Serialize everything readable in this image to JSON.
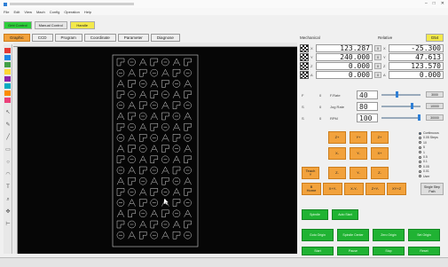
{
  "window": {
    "title": "",
    "controls": [
      "–",
      "□",
      "✕"
    ]
  },
  "menu": {
    "items": [
      "File",
      "Edit",
      "View",
      "Mach",
      "Config",
      "Operation",
      "Help"
    ]
  },
  "modes": [
    {
      "label": "Grbl Control",
      "color": "#2ccf3a"
    },
    {
      "label": "Manual Control",
      "color": "#e6e6e6"
    },
    {
      "label": "Handle",
      "color": "#f3e94a"
    }
  ],
  "tabs": [
    {
      "label": "Graphic",
      "active": true
    },
    {
      "label": "CCD",
      "active": false
    },
    {
      "label": "Program",
      "active": false
    },
    {
      "label": "Coordinate",
      "active": false
    },
    {
      "label": "Parameter",
      "active": false
    },
    {
      "label": "Diagnose",
      "active": false
    }
  ],
  "palette": [
    "#e53935",
    "#1e88e5",
    "#43a047",
    "#fdd835",
    "#8e24aa",
    "#00acc1",
    "#fb8c00",
    "#ec407a"
  ],
  "tools": [
    "pointer-icon",
    "pencil-icon",
    "line-icon",
    "rect-icon",
    "circle-icon",
    "arc-icon",
    "text-icon",
    "zoom-icon",
    "pan-icon",
    "measure-icon"
  ],
  "coords": {
    "mechanical_label": "Mechanical",
    "relative_label": "Relative",
    "g54_label": "G54",
    "g54_color": "#f3e94a",
    "rows": [
      {
        "axis": "X",
        "mech": "123.287",
        "rel": "-25.300"
      },
      {
        "axis": "Y",
        "mech": "240.000",
        "rel": "47.613"
      },
      {
        "axis": "Z",
        "mech": "0.000",
        "rel": "123.570"
      },
      {
        "axis": "A",
        "mech": "0.000",
        "rel": "0.000"
      }
    ]
  },
  "overrides": [
    {
      "key": "F",
      "label": "F.Rate",
      "value": "40",
      "level": 0.4,
      "max_btn": "3000"
    },
    {
      "key": "S",
      "label": "Jog Rate",
      "value": "80",
      "level": 0.8,
      "max_btn": "10000"
    },
    {
      "key": "S",
      "label": "RPM",
      "value": "100",
      "level": 1.0,
      "max_btn": "30000"
    }
  ],
  "jog": {
    "row1": [
      "Z+",
      "Y+",
      "Z+"
    ],
    "row2": [
      "X-",
      "Y-",
      "X+"
    ],
    "row3_left": "Teach\nY",
    "row3": [
      "Z-",
      "Y-",
      "Z-"
    ],
    "row4": [
      "B\nHome",
      "X+Y-",
      "X-Y-",
      "Z+Y-",
      "XY+Z"
    ],
    "single_step": "Single Step\nPath"
  },
  "step_options": [
    "Continuous",
    "0.05 Steps",
    "10",
    "5",
    "1",
    "0.5",
    "0.1",
    "0.05",
    "0.01",
    "User"
  ],
  "green_buttons": {
    "row1": [
      "Spindle",
      "Auto Start"
    ],
    "row2": [
      "Goto Origin",
      "Spindle Center",
      "Zero Origin",
      "Set Origin"
    ],
    "row3": [
      "Start",
      "Pause",
      "Stop",
      "Reset"
    ]
  }
}
